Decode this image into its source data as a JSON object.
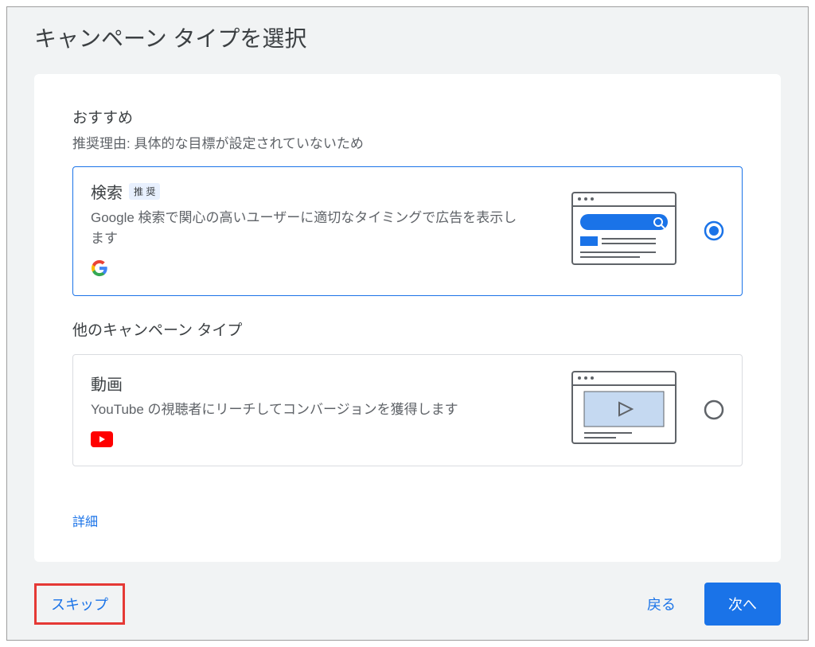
{
  "page": {
    "title": "キャンペーン タイプを選択"
  },
  "recommended": {
    "heading": "おすすめ",
    "reason": "推奨理由: 具体的な目標が設定されていないため",
    "card": {
      "title": "検索",
      "badge": "推 奨",
      "description": "Google 検索で関心の高いユーザーに適切なタイミングで広告を表示します",
      "selected": true
    }
  },
  "other": {
    "heading": "他のキャンペーン タイプ",
    "card": {
      "title": "動画",
      "description": "YouTube の視聴者にリーチしてコンバージョンを獲得します",
      "selected": false
    }
  },
  "links": {
    "details": "詳細"
  },
  "footer": {
    "skip": "スキップ",
    "back": "戻る",
    "next": "次へ"
  }
}
